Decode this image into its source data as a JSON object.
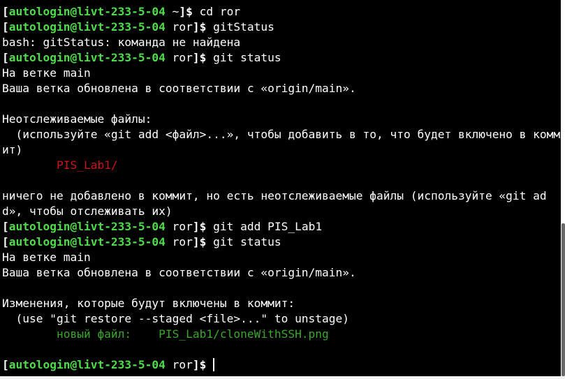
{
  "terminal": {
    "lines": [
      {
        "type": "prompt",
        "user": "autologin@livt-233-5-04",
        "dir": "~",
        "cmd": "cd ror"
      },
      {
        "type": "prompt",
        "user": "autologin@livt-233-5-04",
        "dir": "ror",
        "cmd": "gitStatus"
      },
      {
        "type": "text",
        "text": "bash: gitStatus: команда не найдена"
      },
      {
        "type": "prompt",
        "user": "autologin@livt-233-5-04",
        "dir": "ror",
        "cmd": "git status"
      },
      {
        "type": "text",
        "text": "На ветке main"
      },
      {
        "type": "text",
        "text": "Ваша ветка обновлена в соответствии с «origin/main»."
      },
      {
        "type": "text",
        "text": ""
      },
      {
        "type": "text",
        "text": "Неотслеживаемые файлы:"
      },
      {
        "type": "text",
        "text": "  (используйте «git add <файл>...», чтобы добавить в то, что будет включено в комм"
      },
      {
        "type": "text",
        "text": "ит)"
      },
      {
        "type": "untracked",
        "text": "        PIS_Lab1/"
      },
      {
        "type": "text",
        "text": ""
      },
      {
        "type": "text",
        "text": "ничего не добавлено в коммит, но есть неотслеживаемые файлы (используйте «git ad"
      },
      {
        "type": "text",
        "text": "d», чтобы отслеживать их)"
      },
      {
        "type": "prompt",
        "user": "autologin@livt-233-5-04",
        "dir": "ror",
        "cmd": "git add PIS_Lab1"
      },
      {
        "type": "prompt",
        "user": "autologin@livt-233-5-04",
        "dir": "ror",
        "cmd": "git status"
      },
      {
        "type": "text",
        "text": "На ветке main"
      },
      {
        "type": "text",
        "text": "Ваша ветка обновлена в соответствии с «origin/main»."
      },
      {
        "type": "text",
        "text": ""
      },
      {
        "type": "text",
        "text": "Изменения, которые будут включены в коммит:"
      },
      {
        "type": "text",
        "text": "  (use \"git restore --staged <file>...\" to unstage)"
      },
      {
        "type": "staged",
        "text": "        новый файл:    PIS_Lab1/cloneWithSSH.png"
      },
      {
        "type": "text",
        "text": ""
      },
      {
        "type": "prompt-active",
        "user": "autologin@livt-233-5-04",
        "dir": "ror",
        "cmd": ""
      }
    ]
  },
  "colors": {
    "background": "#000000",
    "foreground": "#ffffff",
    "prompt_user": "#4fdc4a",
    "untracked": "#c8151b",
    "staged": "#3aa62a"
  }
}
